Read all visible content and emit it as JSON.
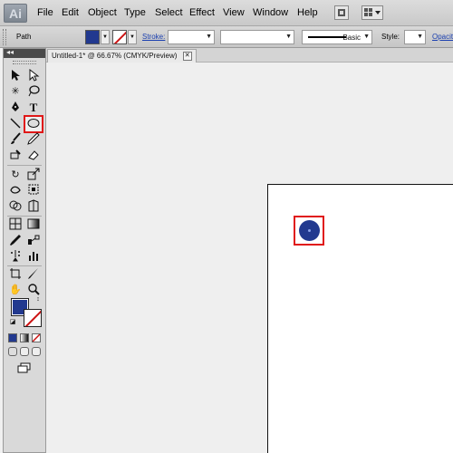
{
  "app": {
    "logo": "Ai"
  },
  "menu": [
    "File",
    "Edit",
    "Object",
    "Type",
    "Select",
    "Effect",
    "View",
    "Window",
    "Help"
  ],
  "control_bar": {
    "selection_label": "Path",
    "stroke_label": "Stroke:",
    "brush_label": "Basic",
    "style_label": "Style:",
    "opacity_label": "Opacit"
  },
  "document_tab": {
    "title": "Untitled-1* @ 66.67% (CMYK/Preview)",
    "close": "✕"
  },
  "tool_panel": {
    "header": "◂◂"
  },
  "colors": {
    "fill": "#22398f",
    "stroke_none": "#cc1111",
    "highlight": "#e01818"
  },
  "icons": [
    "ai-logo-icon",
    "bridge-icon",
    "arrange-documents-icon",
    "selection-tool-icon",
    "direct-selection-tool-icon",
    "magic-wand-icon",
    "lasso-icon",
    "pen-tool-icon",
    "type-tool-icon",
    "line-tool-icon",
    "ellipse-tool-icon",
    "paintbrush-icon",
    "pencil-icon",
    "blob-brush-icon",
    "eraser-icon",
    "rotate-icon",
    "scale-icon",
    "warp-icon",
    "free-transform-icon",
    "shape-builder-icon",
    "perspective-icon",
    "mesh-icon",
    "gradient-icon",
    "eyedropper-icon",
    "blend-icon",
    "symbol-sprayer-icon",
    "graph-icon",
    "artboard-tool-icon",
    "slice-icon",
    "hand-icon",
    "zoom-icon",
    "swap-colors-icon",
    "default-colors-icon",
    "screen-mode-icon"
  ]
}
